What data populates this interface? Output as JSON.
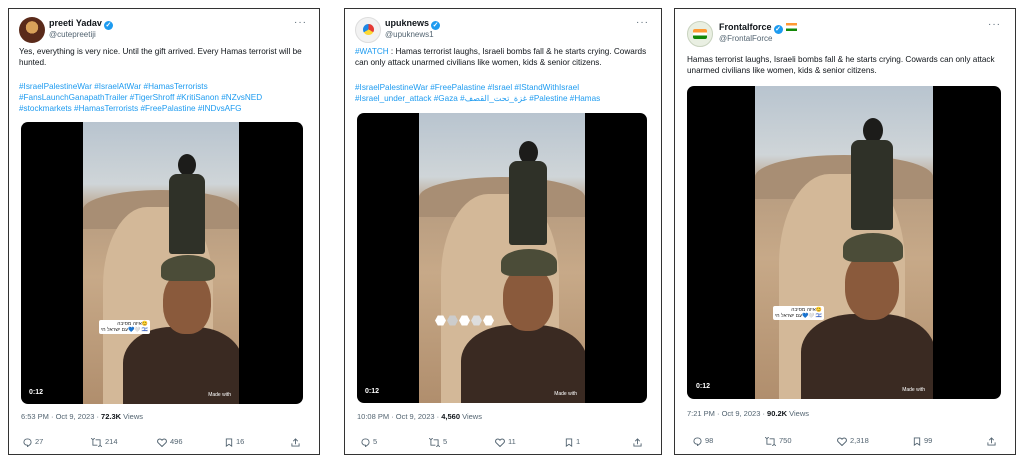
{
  "tweets": [
    {
      "name": "preeti Yadav",
      "handle": "@cutepreetiji",
      "more": "···",
      "text": "Yes, everything is very nice. Until the gift arrived. Every Hamas terrorist will be hunted.",
      "tags1": "#IsraelPalestineWar #IsraelAtWar #HamasTerrorists",
      "tags2": "#FansLaunchGanapathTrailer #TigerShroff #KritiSanon #NZvsNED",
      "tags3": "#stockmarkets #HamasTerrorists #FreePalastine #INDvsAFG",
      "video_time": "0:12",
      "made_with": "Made with",
      "stamp_line1": "איזה מסיבה😊",
      "stamp_line2": "עם ישראל חי💙🤍 🇮🇱",
      "timestamp": "6:53 PM · Oct 9, 2023 · ",
      "views": "72.3K",
      "views_label": " Views",
      "replies": "27",
      "reposts": "214",
      "likes": "496",
      "bookmarks": "16"
    },
    {
      "name": "upuknews",
      "handle": "@upuknews1",
      "more": "···",
      "watch": "#WATCH",
      "text": " : Hamas terrorist laughs, Israeli bombs fall & he starts crying. Cowards can only attack unarmed civilians like women, kids & senior citizens.",
      "tags1": "#IsraelPalestineWar #FreePalastine #Israel #IStandWithIsrael",
      "tags2": "#Israel_under_attack #Gaza #غزة_تحت_القصف #Palestine #Hamas",
      "video_time": "0:12",
      "made_with": "Made with",
      "stamp_line1": "",
      "stamp_line2": "",
      "timestamp": "10:08 PM · Oct 9, 2023 · ",
      "views": "4,560",
      "views_label": " Views",
      "replies": "5",
      "reposts": "5",
      "likes": "11",
      "bookmarks": "1"
    },
    {
      "name": "Frontalforce",
      "handle": "@FrontalForce",
      "more": "···",
      "text": "Hamas terrorist laughs, Israeli bombs fall & he starts crying. Cowards can only attack unarmed civilians like women, kids & senior citizens.",
      "video_time": "0:12",
      "made_with": "Made with",
      "stamp_line1": "איזה מסיבה😊",
      "stamp_line2": "עם ישראל חי💙🤍 🇮🇱",
      "timestamp": "7:21 PM · Oct 9, 2023 · ",
      "views": "90.2K",
      "views_label": " Views",
      "replies": "98",
      "reposts": "750",
      "likes": "2,318",
      "bookmarks": "99"
    }
  ],
  "colors": {
    "link": "#1d9bf0",
    "muted": "#536471",
    "verified": "#1d9bf0"
  }
}
